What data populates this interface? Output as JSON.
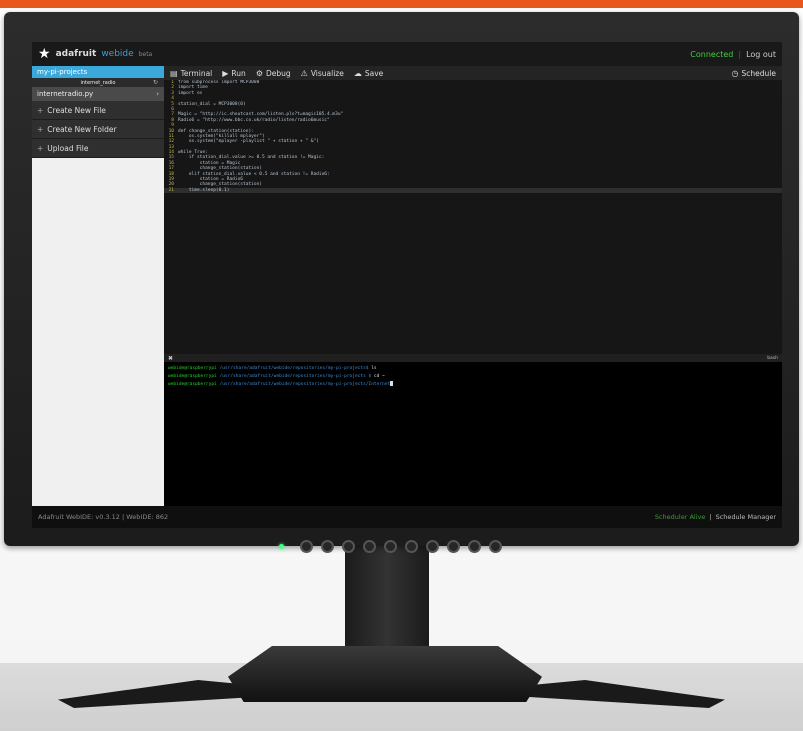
{
  "header": {
    "brand": "adafruit",
    "product": "webide",
    "beta": "beta",
    "status": "Connected",
    "separator": "|",
    "logout": "Log out"
  },
  "sidebar": {
    "project_label": "my-pi-projects",
    "folder_label": "internet_radio",
    "refresh_icon": "↻",
    "file_label": "internetradio.py",
    "file_arrow": "›",
    "items": [
      {
        "plus": "+",
        "label": "Create New File"
      },
      {
        "plus": "+",
        "label": "Create New Folder"
      },
      {
        "plus": "+",
        "label": "Upload File"
      }
    ]
  },
  "toolbar": {
    "terminal": "Terminal",
    "run": "Run",
    "debug": "Debug",
    "visualize": "Visualize",
    "save": "Save",
    "schedule": "Schedule"
  },
  "editor": {
    "lines": [
      {
        "n": "1",
        "code": "from subprocess import MCP3008"
      },
      {
        "n": "2",
        "code": "import time"
      },
      {
        "n": "3",
        "code": "import os"
      },
      {
        "n": "4",
        "code": ""
      },
      {
        "n": "5",
        "code": "station_dial = MCP3008(0)"
      },
      {
        "n": "6",
        "code": ""
      },
      {
        "n": "7",
        "code": "Magic = \"http://ic.shoutcast.com/listen.pls?t=magic105.4.m3u\""
      },
      {
        "n": "8",
        "code": "Radio6 = \"http://www.bbc.co.uk/radio/listen/radio6music\""
      },
      {
        "n": "9",
        "code": ""
      },
      {
        "n": "10",
        "code": "def change_station(station):"
      },
      {
        "n": "11",
        "code": "    os.system(\"killall mplayer\")"
      },
      {
        "n": "12",
        "code": "    os.system(\"mplayer -playlist \" + station + \" &\")"
      },
      {
        "n": "13",
        "code": ""
      },
      {
        "n": "14",
        "code": "while True:"
      },
      {
        "n": "15",
        "code": "    if station_dial.value >= 0.5 and station != Magic:"
      },
      {
        "n": "16",
        "code": "        station = Magic"
      },
      {
        "n": "17",
        "code": "        change_station(station)"
      },
      {
        "n": "18",
        "code": "    elif station_dial.value < 0.5 and station != Radio6:"
      },
      {
        "n": "19",
        "code": "        station = Radio6"
      },
      {
        "n": "20",
        "code": "        change_station(station)"
      },
      {
        "n": "21",
        "code": "    time.sleep(0.1)"
      }
    ],
    "active_line": "21"
  },
  "terminal": {
    "close_icon": "✖",
    "label": "bash",
    "lines": [
      {
        "prompt": "webide@raspberrypi",
        "path": " /usr/share/adafruit/webide/repositories/my-pi-projects$ ",
        "cmd": "ls",
        "cursor": false
      },
      {
        "prompt": "webide@raspberrypi",
        "path": " /usr/share/adafruit/webide/repositories/my-pi-projects $ ",
        "cmd": "cd ~",
        "cursor": false
      },
      {
        "prompt": "webide@raspberrypi",
        "path": " /usr/share/adafruit/webide/repositories/my-pi-projects/Internet",
        "cmd": "",
        "cursor": true
      }
    ]
  },
  "footer": {
    "version": "Adafruit WebIDE: v0.3.12 | WebIDE: 862",
    "scheduler": "Scheduler Alive",
    "divider": "|",
    "manager": "Schedule Manager"
  },
  "colors": {
    "accent_blue": "#3aa8db",
    "brand_orange": "#e8581c",
    "status_green": "#4c4"
  }
}
